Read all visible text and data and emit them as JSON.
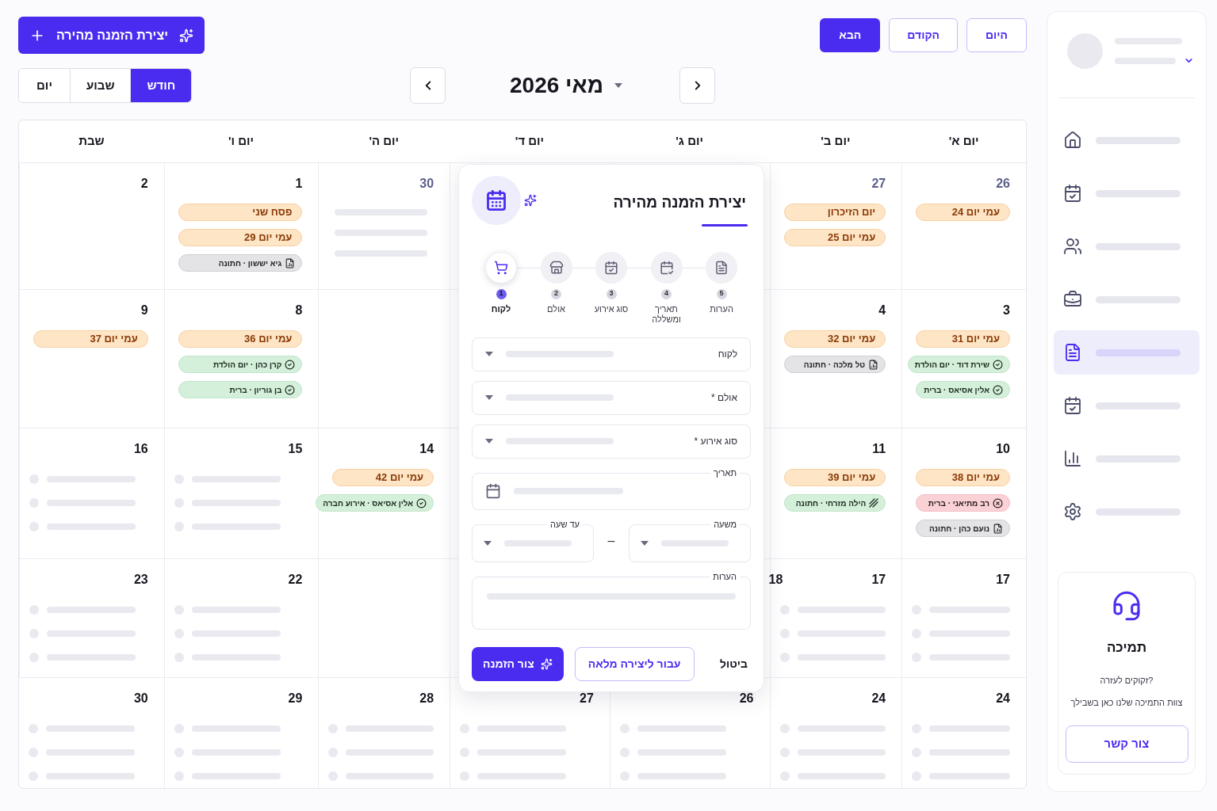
{
  "create_button": {
    "label": "יצירת הזמנה מהירה"
  },
  "nav_buttons": [
    {
      "label": "היום",
      "primary": false
    },
    {
      "label": "הקודם",
      "primary": false
    },
    {
      "label": "הבא",
      "primary": true
    }
  ],
  "views": [
    {
      "label": "חודש",
      "selected": true
    },
    {
      "label": "שבוע",
      "selected": false
    },
    {
      "label": "יום",
      "selected": false
    }
  ],
  "month": {
    "title": "מאי 2026"
  },
  "weekdays": [
    "יום א'",
    "יום ב'",
    "יום ג'",
    "יום ד'",
    "יום ה'",
    "יום ו'",
    "שבת"
  ],
  "weeks": [
    {
      "cells": [
        {
          "kind": "events",
          "day": "26",
          "muted": true,
          "events": [
            {
              "kind": "note",
              "label": "עמי יום 24"
            }
          ]
        },
        {
          "kind": "events",
          "day": "27",
          "muted": true,
          "events": [
            {
              "kind": "note",
              "label": "יום הזיכרון"
            },
            {
              "kind": "note",
              "label": "עמי יום 25"
            }
          ]
        },
        {
          "kind": "empty"
        },
        {
          "kind": "empty"
        },
        {
          "kind": "lines",
          "day": "30",
          "muted": true
        },
        {
          "kind": "events",
          "day": "1",
          "muted": false,
          "events": [
            {
              "kind": "note",
              "label": "פסח שני"
            },
            {
              "kind": "note",
              "label": "עמי יום 29"
            },
            {
              "kind": "pending",
              "label": "גיא יששון · חתונה"
            }
          ]
        },
        {
          "kind": "empty",
          "day": "2",
          "muted": false
        }
      ]
    },
    {
      "cells": [
        {
          "kind": "events",
          "day": "3",
          "muted": false,
          "events": [
            {
              "kind": "note",
              "label": "עמי יום 31"
            },
            {
              "kind": "confirmed",
              "label": "שירת דוד · יום הולדת"
            },
            {
              "kind": "confirmed",
              "label": "אלין אסיאס · ברית"
            }
          ]
        },
        {
          "kind": "events",
          "day": "4",
          "muted": false,
          "events": [
            {
              "kind": "note",
              "label": "עמי יום 32"
            },
            {
              "kind": "pending",
              "label": "טל מלכה · חתונה"
            }
          ]
        },
        {
          "kind": "empty"
        },
        {
          "kind": "empty"
        },
        {
          "kind": "empty"
        },
        {
          "kind": "events",
          "day": "8",
          "muted": false,
          "events": [
            {
              "kind": "note",
              "label": "עמי יום 36"
            },
            {
              "kind": "confirmed",
              "label": "קרן כהן · יום הולדת"
            },
            {
              "kind": "confirmed",
              "label": "בן גוריון · ברית"
            }
          ]
        },
        {
          "kind": "events",
          "day": "9",
          "muted": false,
          "events": [
            {
              "kind": "note",
              "label": "עמי יום 37"
            }
          ]
        }
      ]
    },
    {
      "cells": [
        {
          "kind": "events",
          "day": "10",
          "muted": false,
          "events": [
            {
              "kind": "note",
              "label": "עמי יום 38"
            },
            {
              "kind": "cancelled",
              "label": "רב מתיאני · ברית"
            },
            {
              "kind": "pending",
              "label": "נועם כהן · חתונה"
            }
          ]
        },
        {
          "kind": "events",
          "day": "11",
          "muted": false,
          "events": [
            {
              "kind": "note",
              "label": "עמי יום 39"
            },
            {
              "kind": "partial",
              "label": "הילה מזרחי · חתונה"
            }
          ]
        },
        {
          "kind": "empty"
        },
        {
          "kind": "empty"
        },
        {
          "kind": "events",
          "day": "14",
          "muted": false,
          "events": [
            {
              "kind": "note",
              "label": "עמי יום 42"
            },
            {
              "kind": "confirmed",
              "label": "אלין אסיאס · אירוע חברה"
            }
          ]
        },
        {
          "kind": "dots",
          "day": "15",
          "muted": false
        },
        {
          "kind": "dots",
          "day": "16",
          "muted": false
        }
      ]
    },
    {
      "cells": [
        {
          "kind": "dots",
          "day": "17",
          "muted": false
        },
        {
          "kind": "dots",
          "day": "17",
          "side_day": "18",
          "muted": false
        },
        {
          "kind": "empty"
        },
        {
          "kind": "empty"
        },
        {
          "kind": "empty"
        },
        {
          "kind": "dots",
          "day": "22",
          "muted": false
        },
        {
          "kind": "dots",
          "day": "23",
          "muted": false
        }
      ]
    },
    {
      "cells": [
        {
          "kind": "dots",
          "day": "24",
          "muted": false
        },
        {
          "kind": "dots",
          "day": "24",
          "muted": false
        },
        {
          "kind": "dots",
          "day": "26",
          "muted": false
        },
        {
          "kind": "dots",
          "day": "27",
          "muted": false
        },
        {
          "kind": "dots",
          "day": "28",
          "muted": false
        },
        {
          "kind": "dots",
          "day": "29",
          "muted": false
        },
        {
          "kind": "dots",
          "day": "30",
          "muted": false
        }
      ]
    }
  ],
  "quick_booking": {
    "title": "יצירת הזמנה מהירה",
    "steps": [
      {
        "number": "5",
        "label": "הערות",
        "selected": false
      },
      {
        "number": "4",
        "label": "תאריך ומשללה",
        "selected": false
      },
      {
        "number": "3",
        "label": "סוג אירוע",
        "selected": false
      },
      {
        "number": "2",
        "label": "אולם",
        "selected": false
      },
      {
        "number": "1",
        "label": "לקוח",
        "selected": true
      }
    ],
    "fields": [
      {
        "kind": "select",
        "label": "לקוח"
      },
      {
        "kind": "select",
        "label": "אולם *"
      },
      {
        "kind": "select",
        "label": "סוג אירוע *"
      },
      {
        "kind": "date",
        "label": "תאריך"
      },
      {
        "kind": "time-range",
        "from_label": "משעה",
        "separator": "–",
        "to_label": "עד שעה"
      },
      {
        "kind": "notes",
        "label": "הערות"
      }
    ],
    "cancel": "ביטול",
    "full_form": "עבור ליצירה מלאה",
    "submit": "צור הזמנה"
  },
  "sidebar": {
    "items": [
      {
        "selected": false
      },
      {
        "selected": false
      },
      {
        "selected": false
      },
      {
        "selected": false
      },
      {
        "selected": true
      },
      {
        "selected": false
      },
      {
        "selected": false
      },
      {
        "selected": false
      }
    ]
  },
  "support": {
    "title": "תמיכה",
    "question": "זקוקים לעזרה?",
    "text": "צוות התמיכה שלנו כאן בשבילך",
    "button": "צור קשר"
  }
}
